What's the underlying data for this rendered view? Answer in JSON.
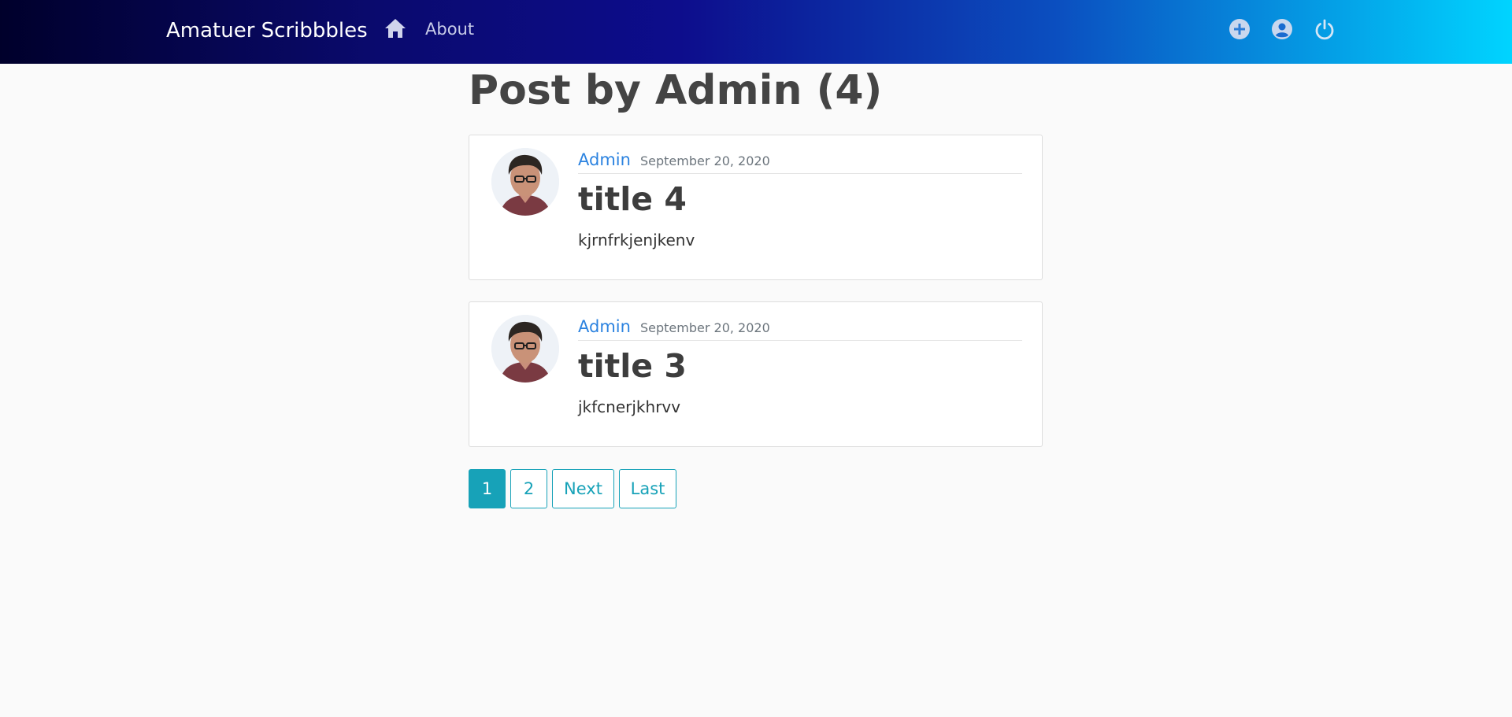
{
  "navbar": {
    "brand": "Amatuer Scribbbles",
    "about_label": "About",
    "icons": [
      "home-icon",
      "add-circle-icon",
      "user-circle-icon",
      "power-icon"
    ]
  },
  "page": {
    "title": "Post by Admin (4)"
  },
  "posts": [
    {
      "author": "Admin",
      "date": "September 20, 2020",
      "title": "title 4",
      "content": "kjrnfrkjenjkenv"
    },
    {
      "author": "Admin",
      "date": "September 20, 2020",
      "title": "title 3",
      "content": "jkfcnerjkhrvv"
    }
  ],
  "pagination": {
    "pages": [
      "1",
      "2"
    ],
    "active": "1",
    "next_label": "Next",
    "last_label": "Last"
  },
  "colors": {
    "accent": "#17a2b8",
    "link": "#2c83e0",
    "background": "#fafafa"
  }
}
